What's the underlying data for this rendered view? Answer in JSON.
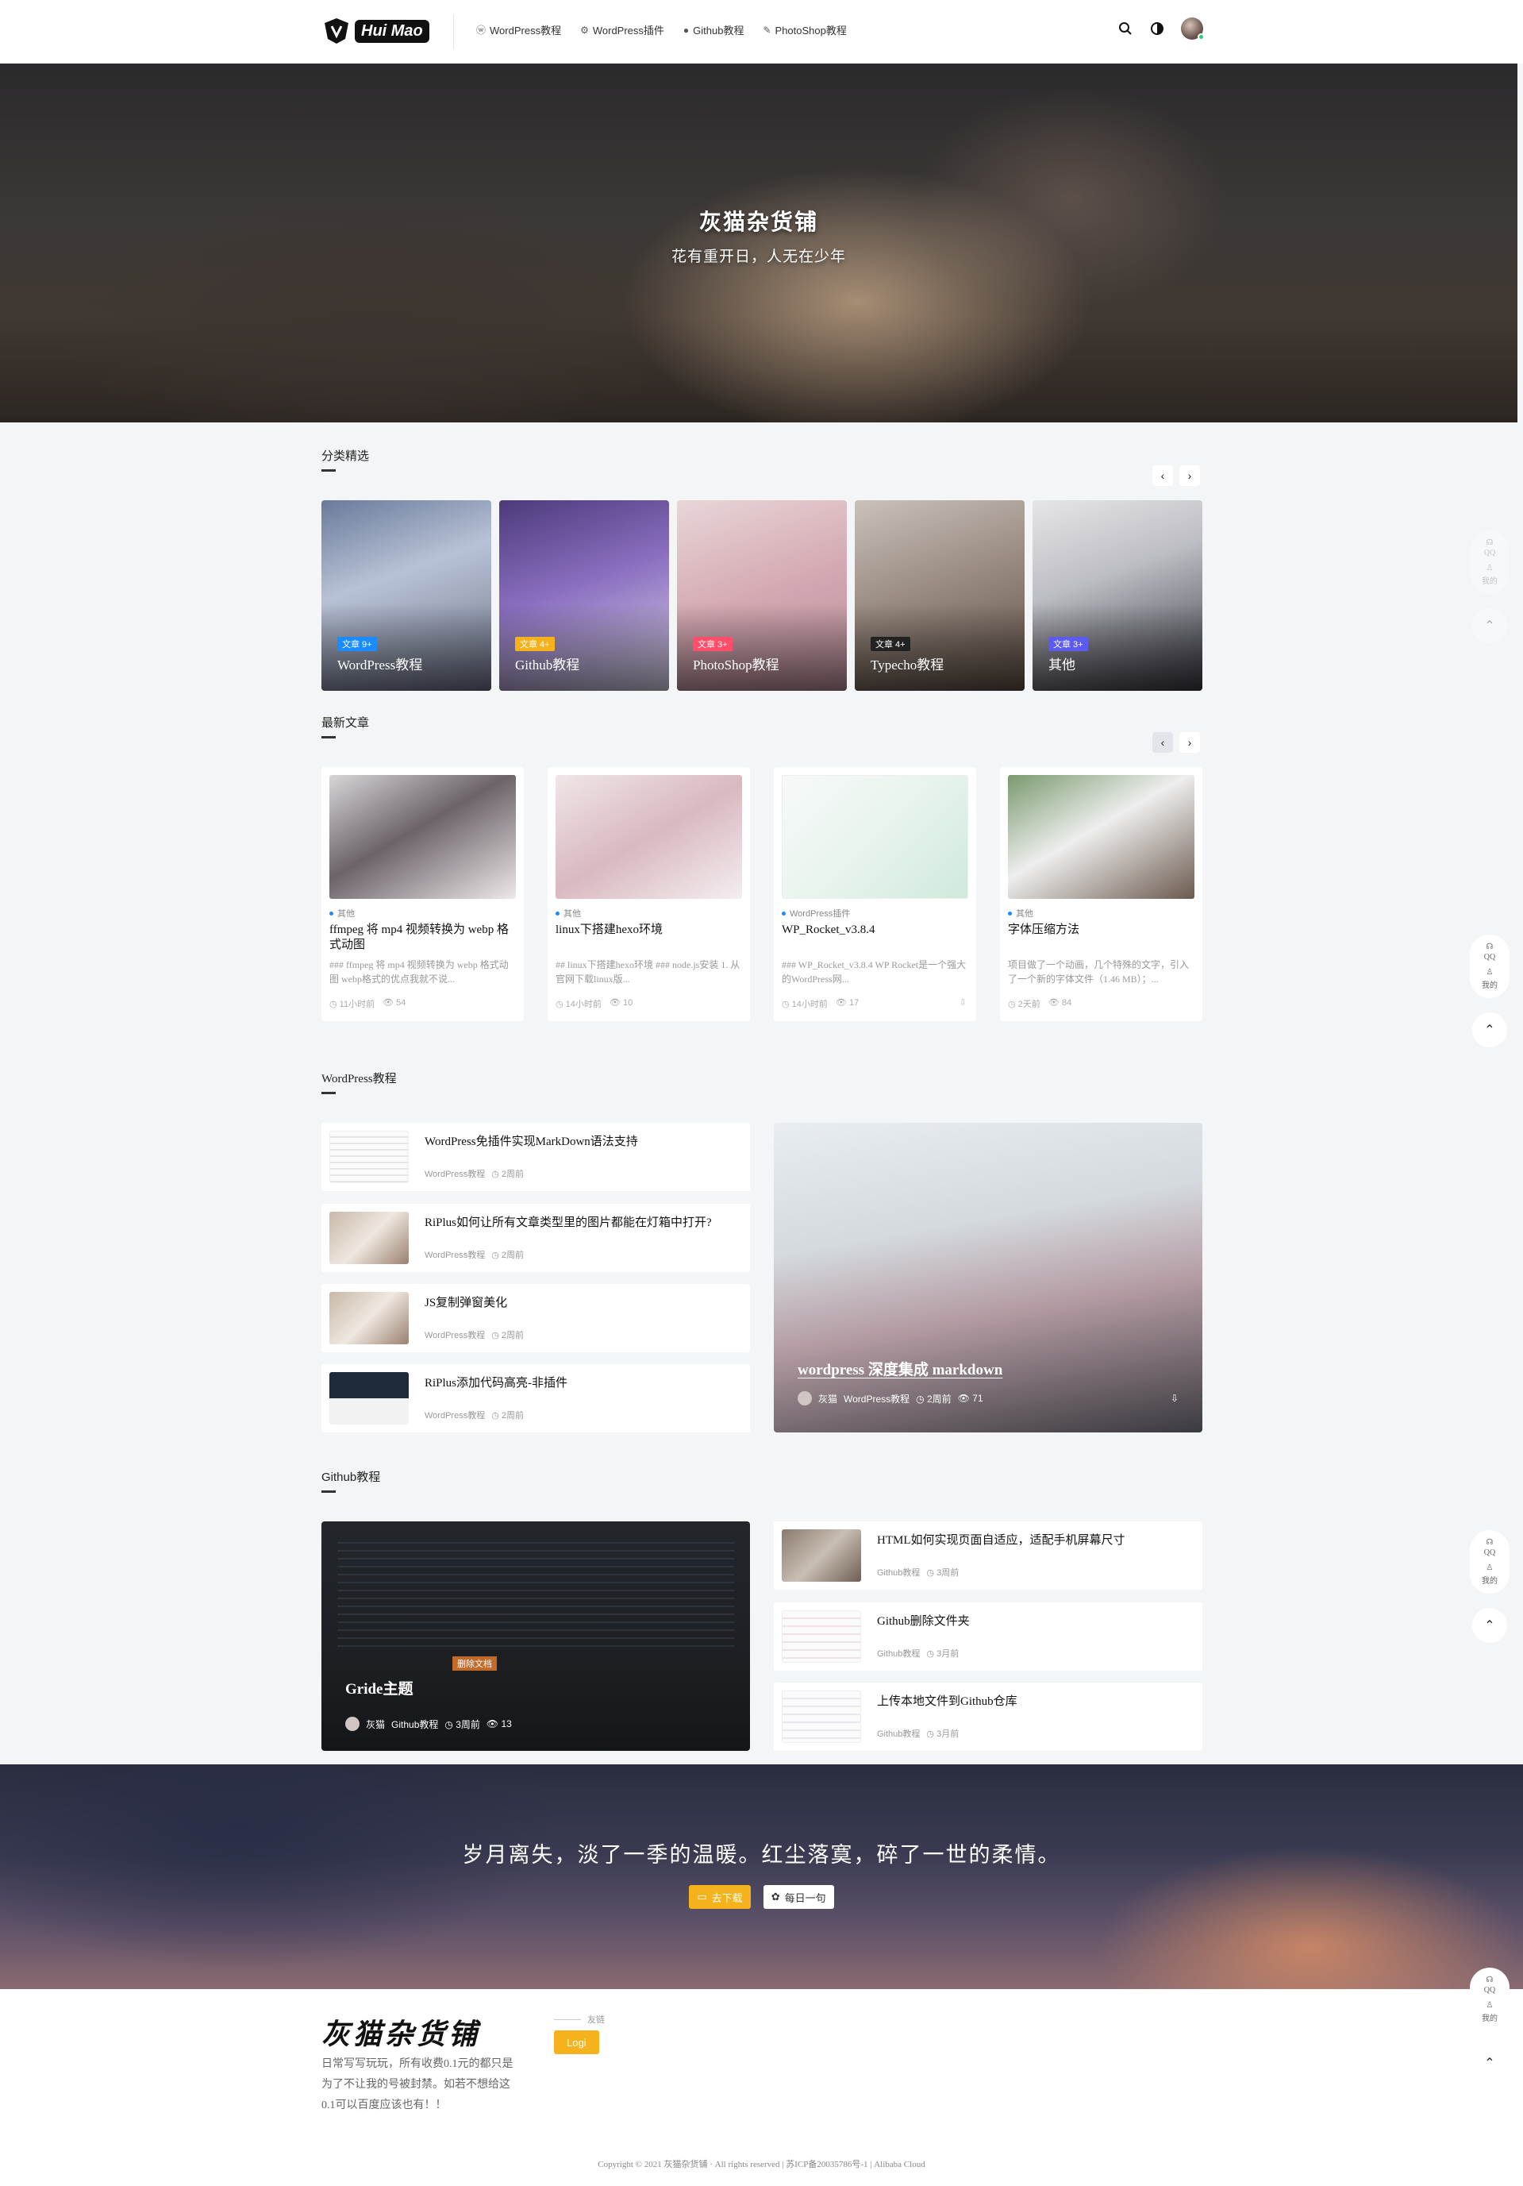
{
  "header": {
    "logo_text": "Hui Mao",
    "nav": [
      {
        "label": "WordPress教程",
        "icon": "wordpress-icon"
      },
      {
        "label": "WordPress插件",
        "icon": "plugin-icon"
      },
      {
        "label": "Github教程",
        "icon": "github-icon"
      },
      {
        "label": "PhotoShop教程",
        "icon": "brush-icon"
      }
    ],
    "icons": [
      "search-icon",
      "theme-toggle-icon",
      "user-avatar"
    ]
  },
  "hero": {
    "title": "灰猫杂货铺",
    "subtitle": "花有重开日，人无在少年"
  },
  "categories": {
    "title": "分类精选",
    "items": [
      {
        "badge": "文章 9+",
        "name": "WordPress教程",
        "badge_color": "#1a8cff"
      },
      {
        "badge": "文章 4+",
        "name": "Github教程",
        "badge_color": "#f5b21c"
      },
      {
        "badge": "文章 3+",
        "name": "PhotoShop教程",
        "badge_color": "#ff4d6a"
      },
      {
        "badge": "文章 4+",
        "name": "Typecho教程",
        "badge_color": "#222222"
      },
      {
        "badge": "文章 3+",
        "name": "其他",
        "badge_color": "#5b5bf0"
      }
    ]
  },
  "latest": {
    "title": "最新文章",
    "posts": [
      {
        "category": "其他",
        "title": "ffmpeg 将 mp4 视频转换为 webp 格式动图",
        "excerpt": "### ffmpeg 将 mp4 视频转换为 webp 格式动图 webp格式的优点我就不说...",
        "time": "11小时前",
        "views": "54",
        "download": ""
      },
      {
        "category": "其他",
        "title": "linux下搭建hexo环境",
        "excerpt": "## linux下搭建hexo环境 ### node.js安装 1. 从官网下载linux版...",
        "time": "14小时前",
        "views": "10",
        "download": ""
      },
      {
        "category": "WordPress插件",
        "title": "WP_Rocket_v3.8.4",
        "excerpt": "### WP_Rocket_v3.8.4 WP Rocket是一个强大的WordPress网...",
        "time": "14小时前",
        "views": "17",
        "download": "⇩"
      },
      {
        "category": "其他",
        "title": "字体压缩方法",
        "excerpt": "项目做了一个动画，几个特殊的文字，引入了一个新的字体文件（1.46 MB）；...",
        "time": "2天前",
        "views": "84",
        "download": ""
      }
    ]
  },
  "wp_section": {
    "title": "WordPress教程",
    "list": [
      {
        "title": "WordPress免插件实现MarkDown语法支持",
        "category": "WordPress教程",
        "time": "2周前"
      },
      {
        "title": "RiPlus如何让所有文章类型里的图片都能在灯箱中打开?",
        "category": "WordPress教程",
        "time": "2周前"
      },
      {
        "title": "JS复制弹窗美化",
        "category": "WordPress教程",
        "time": "2周前"
      },
      {
        "title": "RiPlus添加代码高亮-非插件",
        "category": "WordPress教程",
        "time": "2周前"
      }
    ],
    "feature": {
      "title": "wordpress 深度集成 markdown",
      "author": "灰猫",
      "category": "WordPress教程",
      "time": "2周前",
      "views": "71"
    }
  },
  "github_section": {
    "title": "Github教程",
    "feature": {
      "title": "Gride主题",
      "author": "灰猫",
      "category": "Github教程",
      "time": "3周前",
      "views": "13",
      "tag": "删除文档"
    },
    "list": [
      {
        "title": "HTML如何实现页面自适应，适配手机屏幕尺寸",
        "category": "Github教程",
        "time": "3周前"
      },
      {
        "title": "Github删除文件夹",
        "category": "Github教程",
        "time": "3月前"
      },
      {
        "title": "上传本地文件到Github仓库",
        "category": "Github教程",
        "time": "3月前"
      }
    ]
  },
  "quote": {
    "text": "岁月离失，淡了一季的温暖。红尘落寞，碎了一世的柔情。",
    "btn_download": "去下载",
    "btn_daily": "每日一句"
  },
  "footer": {
    "logo": "灰猫杂货铺",
    "description": "日常写写玩玩，所有收费0.1元的都只是为了不让我的号被封禁。如若不想给这0.1可以百度应该也有！！",
    "links_label": "友链",
    "link_button": "Logi",
    "copyright": "Copyright © 2021 灰猫杂货铺 · All rights reserved |  苏ICP备20035786号-1  |  Alibaba Cloud"
  },
  "side": {
    "qq": "QQ",
    "mine": "我的"
  }
}
